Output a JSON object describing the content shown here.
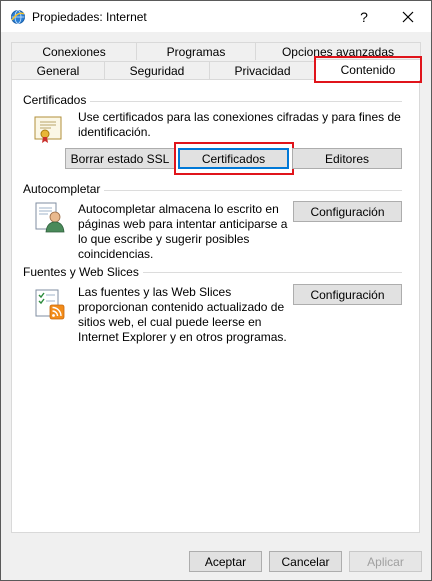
{
  "window": {
    "title": "Propiedades: Internet",
    "help_glyph": "?",
    "close_glyph": "✕"
  },
  "tabs": {
    "row1": [
      "Conexiones",
      "Programas",
      "Opciones avanzadas"
    ],
    "row2": [
      "General",
      "Seguridad",
      "Privacidad",
      "Contenido"
    ],
    "active": "Contenido"
  },
  "certificados": {
    "title": "Certificados",
    "description": [
      "Use certificados para las conexiones cifradas y para fines de",
      "identificación."
    ],
    "buttons": [
      "Borrar estado SSL",
      "Certificados",
      "Editores"
    ]
  },
  "autocompletar": {
    "title": "Autocompletar",
    "description": [
      "Autocompletar almacena lo escrito en",
      "páginas web para intentar anticiparse a",
      "lo que escribe y sugerir posibles",
      "coincidencias."
    ],
    "button": "Configuración"
  },
  "fuentes": {
    "title": "Fuentes y Web Slices",
    "description": [
      "Las fuentes y las Web Slices",
      "proporcionan contenido actualizado de",
      "sitios web, el cual puede leerse en",
      "Internet Explorer y en otros programas."
    ],
    "button": "Configuración"
  },
  "footer": {
    "aceptar": "Aceptar",
    "cancelar": "Cancelar",
    "aplicar": "Aplicar"
  },
  "colors": {
    "highlight": "#e0141b",
    "focus": "#0078d7"
  },
  "icons": [
    "ie-globe-icon",
    "close-icon",
    "certificate-icon",
    "autocomplete-user-icon",
    "feeds-icon"
  ]
}
